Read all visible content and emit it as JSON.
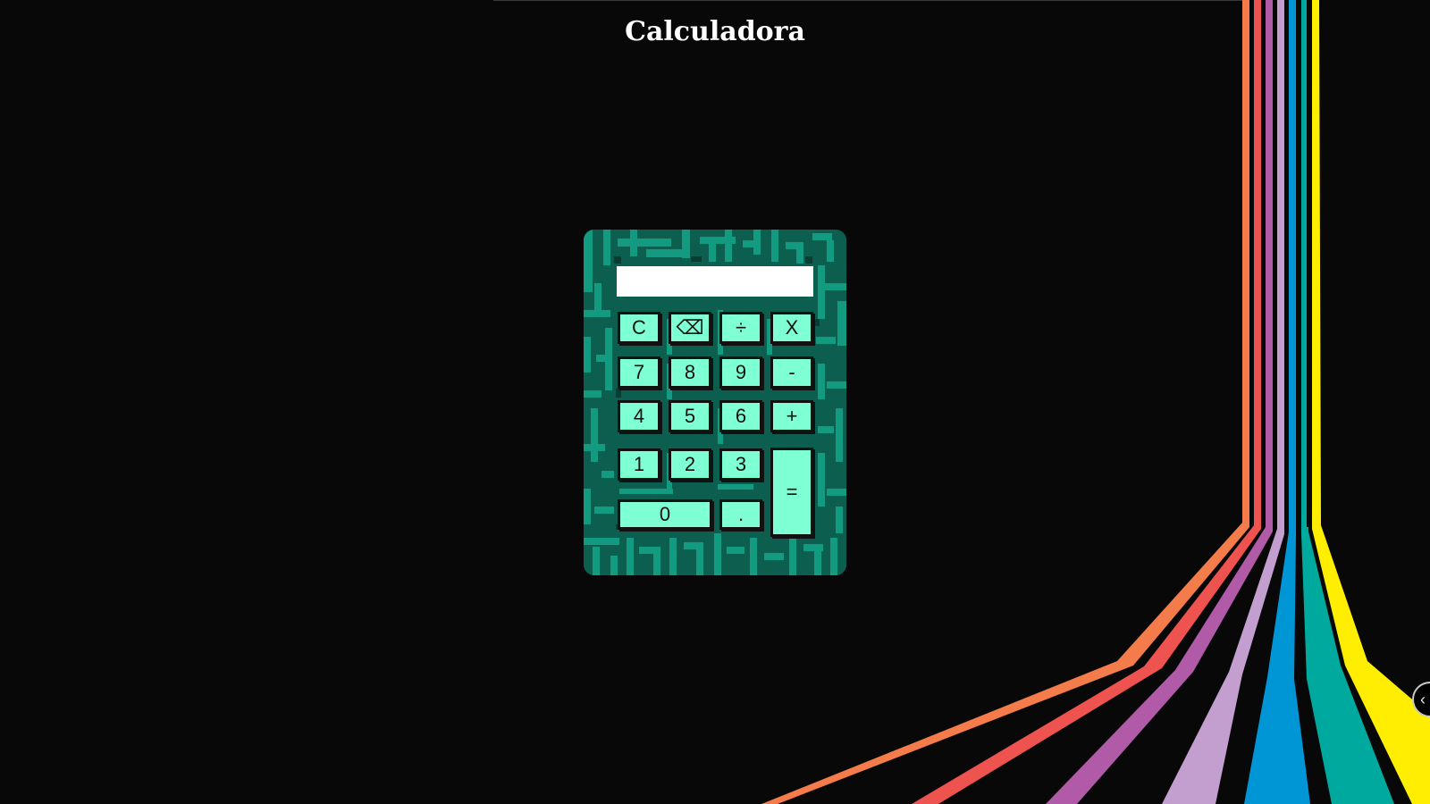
{
  "page": {
    "title": "Calculadora"
  },
  "display": {
    "value": ""
  },
  "keys": {
    "clear": "C",
    "backspace": "⌫",
    "divide": "÷",
    "multiply": "X",
    "seven": "7",
    "eight": "8",
    "nine": "9",
    "minus": "-",
    "four": "4",
    "five": "5",
    "six": "6",
    "plus": "+",
    "one": "1",
    "two": "2",
    "three": "3",
    "equals": "=",
    "zero": "0",
    "decimal": "."
  },
  "side_toggle": {
    "icon": "chevron-left-icon",
    "glyph": "‹"
  },
  "colors": {
    "background": "#080808",
    "calculator_base": "#0c5e4f",
    "maze_light": "#139b82",
    "key_fill": "#7fffd4",
    "stripes": [
      "#f47c4a",
      "#ef5350",
      "#b05aa8",
      "#c39fcf",
      "#0096d6",
      "#00a99d",
      "#ffee00"
    ]
  }
}
